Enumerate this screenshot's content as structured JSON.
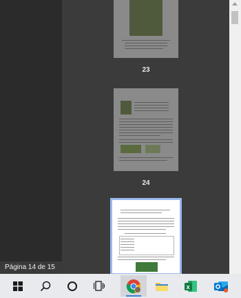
{
  "thumbnails": [
    {
      "number": "23"
    },
    {
      "number": "24"
    }
  ],
  "status": {
    "page_indicator": "Página 14 de 15"
  },
  "taskbar": {
    "items": [
      {
        "name": "start",
        "icon": "windows-logo-icon"
      },
      {
        "name": "search",
        "icon": "search-icon"
      },
      {
        "name": "cortana",
        "icon": "cortana-circle-icon"
      },
      {
        "name": "task-view",
        "icon": "task-view-icon"
      },
      {
        "name": "chrome",
        "icon": "chrome-icon",
        "active": true
      },
      {
        "name": "file-explorer",
        "icon": "folder-icon"
      },
      {
        "name": "excel",
        "icon": "excel-icon"
      },
      {
        "name": "outlook",
        "icon": "outlook-icon"
      }
    ]
  },
  "colors": {
    "accent": "#3b80d6",
    "selected_border": "#9ab9ec"
  }
}
